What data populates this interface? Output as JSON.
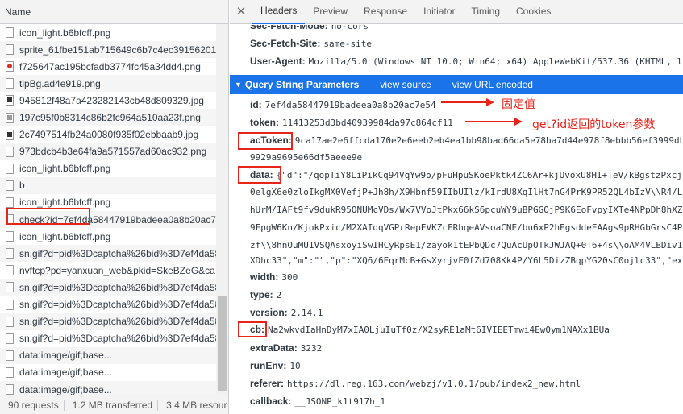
{
  "left_panel": {
    "header": "Name",
    "requests": [
      {
        "name": "icon_light.b6bfcff.png",
        "icon": "file"
      },
      {
        "name": "sprite_61fbe151ab715649c6b7c4ec39156201...",
        "icon": "file"
      },
      {
        "name": "f725647ac195bcfadb3774fc45a34dd4.png",
        "icon": "red"
      },
      {
        "name": "tipBg.ad4e919.png",
        "icon": "file"
      },
      {
        "name": "945812f48a7a423282143cb48d809329.jpg",
        "icon": "dark"
      },
      {
        "name": "197c95f0b8314c86b2fc964a510aa23f.png",
        "icon": "gray"
      },
      {
        "name": "2c7497514fb24a0080f935f02ebbaab9.jpg",
        "icon": "dark"
      },
      {
        "name": "973bdcb4b3e64fa9a571557ad60ac932.png",
        "icon": "file"
      },
      {
        "name": "icon_light.b6bfcff.png",
        "icon": "file"
      },
      {
        "name": "b",
        "icon": "file"
      },
      {
        "name": "icon_light.b6bfcff.png",
        "icon": "file"
      },
      {
        "name": "check?id=7ef4da58447919badeea0a8b20ac7e",
        "icon": "file"
      },
      {
        "name": "icon_light.b6bfcff.png",
        "icon": "file"
      },
      {
        "name": "sn.gif?d=pid%3Dcaptcha%26bid%3D7ef4da58",
        "icon": "file"
      },
      {
        "name": "nvftcp?pd=yanxuan_web&pkid=SkeBZeG&ca",
        "icon": "file"
      },
      {
        "name": "sn.gif?d=pid%3Dcaptcha%26bid%3D7ef4da58",
        "icon": "file"
      },
      {
        "name": "sn.gif?d=pid%3Dcaptcha%26bid%3D7ef4da58",
        "icon": "file"
      },
      {
        "name": "sn.gif?d=pid%3Dcaptcha%26bid%3D7ef4da58",
        "icon": "file"
      },
      {
        "name": "sn.gif?d=pid%3Dcaptcha%26bid%3D7ef4da58",
        "icon": "file"
      },
      {
        "name": "data:image/gif;base...",
        "icon": "file"
      },
      {
        "name": "data:image/gif;base...",
        "icon": "file"
      },
      {
        "name": "data:image/gif;base...",
        "icon": "file"
      }
    ],
    "status": {
      "requests": "90 requests",
      "transferred": "1.2 MB transferred",
      "resources": "3.4 MB resour"
    }
  },
  "right_panel": {
    "tabs": [
      "Headers",
      "Preview",
      "Response",
      "Initiator",
      "Timing",
      "Cookies"
    ],
    "active_tab": "Headers",
    "request_headers": [
      {
        "key": "Sec-Fetch-Mode:",
        "value": "no-cors"
      },
      {
        "key": "Sec-Fetch-Site:",
        "value": "same-site"
      },
      {
        "key": "User-Agent:",
        "value": "Mozilla/5.0 (Windows NT 10.0; Win64; x64) AppleWebKit/537.36 (KHTML, l"
      }
    ],
    "query_section": {
      "title": "Query String Parameters",
      "view_source": "view source",
      "view_url_encoded": "view URL encoded"
    },
    "params": {
      "id_key": "id:",
      "id_value": "7ef4da58447919badeea0a8b20ac7e54",
      "token_key": "token:",
      "token_value": "11413253d3bd40939984da97c864cf11",
      "actoken_key": "acToken:",
      "actoken_value": "9ca17ae2e6ffcda170e2e6eeb2eb4ea1bb98bad66da5e78ba7d44e978f8ebbb56ef3999db",
      "actoken_cont": "9929a9695e66df5aeee9e",
      "data_key": "data:",
      "data_value": "{\"d\":\"/qopTiY8LiPikCq94VqYw9o/pFuHpuSKoePktk4ZC6Ar+kjUvoxU8HI+TeV/kBgstzPxcj",
      "data_cont": [
        "0elgX6e0zloIkgMX0VefjP+Jh8h/X9Hbnf59IIbUIlz/kIrdU8XqIlHt7nG4PrK9PR52QL4bIzV\\\\R4/L",
        "hUrM/IAFt9fv9dukR95ONUMcVDs/Wx7VVoJtPkx66kS6pcuWY9uBPGGOjP9K6EoFvpyIXTe4NPpDh8hXZ9",
        "9FpgW6Kn/KjokPxic/M2XAIdqVGPrRepEVKZcFRhqeAVsoaCNE/bu6xP2hEgsddeEAAgs9pRHGbGrsC4Pa",
        "zf\\\\8hnOuMU1VSQAsxoyiSwIHCyRpsE1/zayok1tEPbQDc7QuAcUpOTkJWJAQ+0T6+4s\\\\oAM4VLBDiv1j",
        "XDhc33\",\"m\":\"\",\"p\":\"XQ6/6EqrMcB+GsXyrjvF0fZd708Kk4P/Y6L5DizZBqpYG20sC0ojlc33\",\"ext"
      ],
      "width_key": "width:",
      "width_value": "300",
      "type_key": "type:",
      "type_value": "2",
      "version_key": "version:",
      "version_value": "2.14.1",
      "cb_key": "cb:",
      "cb_value": "Na2wkvdIaHnDyM7xIA0LjuIuTf0z/X2syRE1aMt6IVIEETmwi4Ew0ym1NAXx1BUa",
      "extra_key": "extraData:",
      "extra_value": "3232",
      "runenv_key": "runEnv:",
      "runenv_value": "10",
      "referer_key": "referer:",
      "referer_value": "https://dl.reg.163.com/webzj/v1.0.1/pub/index2_new.html",
      "callback_key": "callback:",
      "callback_value": "__JSONP_k1t917h_1"
    },
    "annotations": {
      "fixed_value": "固定值",
      "token_note": "get?id返回的token参数"
    }
  },
  "colors": {
    "accent": "#1a73e8",
    "annotation": "#e8231a"
  }
}
